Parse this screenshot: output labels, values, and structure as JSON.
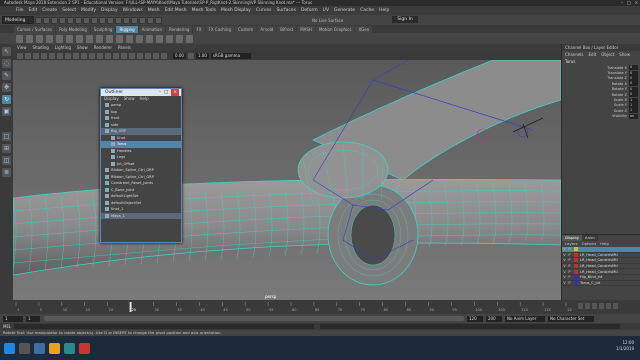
{
  "window": {
    "title": "Autodesk Maya 2018 Extension 2 SP1 - Educational Version: F:\\ULL-\\SP-MAYA\\Knot\\Maya Tutorials\\SP-P_Rig\\Knot-2.Skinning\\VP Skinning Knot.ma* --- Torus",
    "controls": [
      "–",
      "□",
      "×"
    ]
  },
  "menubar": [
    "File",
    "Edit",
    "Create",
    "Select",
    "Modify",
    "Display",
    "Windows",
    "Mesh",
    "Edit Mesh",
    "Mesh Tools",
    "Mesh Display",
    "Curves",
    "Surfaces",
    "Deform",
    "UV",
    "Generate",
    "Cache",
    "Help"
  ],
  "statusline": {
    "mode": "Modeling",
    "live_surface": "No Live Surface",
    "sign_in": "Sign In"
  },
  "shelf_tabs": [
    {
      "label": "Curves / Surfaces",
      "active": false
    },
    {
      "label": "Poly Modeling",
      "active": false
    },
    {
      "label": "Sculpting",
      "active": false
    },
    {
      "label": "Rigging",
      "active": true
    },
    {
      "label": "Animation",
      "active": false
    },
    {
      "label": "Rendering",
      "active": false
    },
    {
      "label": "FX",
      "active": false
    },
    {
      "label": "FX Caching",
      "active": false
    },
    {
      "label": "Custom",
      "active": false
    },
    {
      "label": "Arnold",
      "active": false
    },
    {
      "label": "Bifrost",
      "active": false
    },
    {
      "label": "MASH",
      "active": false
    },
    {
      "label": "Motion Graphics",
      "active": false
    },
    {
      "label": "XGen",
      "active": false
    }
  ],
  "panel_menu": [
    "View",
    "Shading",
    "Lighting",
    "Show",
    "Renderer",
    "Panels"
  ],
  "panel_toolbar": {
    "near": "0.00",
    "far": "1.00",
    "colorspace": "sRGB gamma"
  },
  "viewport": {
    "camera_label": "persp",
    "mesh_color": "#8a8a8a",
    "wire_color": "#39d6c8",
    "joint_color": "#3a3ac8"
  },
  "channel_box": {
    "header": "Channel Box / Layer Editor",
    "menu": [
      "Channels",
      "Edit",
      "Object",
      "Show"
    ],
    "object": "Torus",
    "attributes": [
      {
        "name": "Translate X",
        "value": "0"
      },
      {
        "name": "Translate Y",
        "value": "0"
      },
      {
        "name": "Translate Z",
        "value": "0"
      },
      {
        "name": "Rotate X",
        "value": "0"
      },
      {
        "name": "Rotate Y",
        "value": "0"
      },
      {
        "name": "Rotate Z",
        "value": "0"
      },
      {
        "name": "Scale X",
        "value": "1"
      },
      {
        "name": "Scale Y",
        "value": "1"
      },
      {
        "name": "Scale Z",
        "value": "1"
      },
      {
        "name": "Visibility",
        "value": "on"
      }
    ]
  },
  "layer_editor": {
    "tabs": [
      {
        "label": "Display",
        "active": true
      },
      {
        "label": "Anim",
        "active": false
      }
    ],
    "menu": [
      "Layers",
      "Options",
      "Help"
    ],
    "layers": [
      {
        "v": "V",
        "p": "P",
        "color": "#d8c020",
        "name": "",
        "selected": true
      },
      {
        "v": "V",
        "p": "P",
        "color": "#c03030",
        "name": "LR_Head_ConstrlsMtl",
        "selected": false
      },
      {
        "v": "V",
        "p": "P",
        "color": "#c03030",
        "name": "LR_Head_ConstrlsMtl",
        "selected": false
      },
      {
        "v": "V",
        "p": "P",
        "color": "#c03030",
        "name": "LR_Head_ConstrlsMtl",
        "selected": false
      },
      {
        "v": "V",
        "p": "P",
        "color": "#c03030",
        "name": "LR_Head_ConstrlsMtl",
        "selected": false
      },
      {
        "v": "V",
        "p": "P",
        "color": "#3030c0",
        "name": "Hip_Bind_Jnt",
        "selected": false
      },
      {
        "v": "V",
        "p": "P",
        "color": "#3030c0",
        "name": "Torus_C_Jnt",
        "selected": false
      }
    ]
  },
  "outliner": {
    "title": "Outliner",
    "menu": [
      "Display",
      "Show",
      "Help"
    ],
    "items": [
      {
        "label": "persp",
        "state": "normal"
      },
      {
        "label": "top",
        "state": "normal"
      },
      {
        "label": "front",
        "state": "normal"
      },
      {
        "label": "side",
        "state": "normal"
      },
      {
        "label": "Rig_GRP",
        "state": "hl"
      },
      {
        "label": "Knot",
        "state": "normal"
      },
      {
        "label": "Torus",
        "state": "sel"
      },
      {
        "label": "Handles",
        "state": "normal"
      },
      {
        "label": "Legs",
        "state": "normal"
      },
      {
        "label": "Jnt_Offset",
        "state": "normal"
      },
      {
        "label": "Ribbon_Spline_Ctrl_GRP",
        "state": "normal"
      },
      {
        "label": "Ribbon_Spline_Ctrl_GRP",
        "state": "normal"
      },
      {
        "label": "Constraint_Reset_Joints",
        "state": "normal"
      },
      {
        "label": "C_Bone_Joint",
        "state": "normal"
      },
      {
        "label": "defaultLightSet",
        "state": "normal"
      },
      {
        "label": "defaultObjectSet",
        "state": "normal"
      },
      {
        "label": "Knot_1",
        "state": "normal"
      },
      {
        "label": "Maya_1",
        "state": "hl"
      }
    ]
  },
  "timeslider": {
    "ticks": [
      "1",
      "5",
      "10",
      "15",
      "20",
      "25",
      "30",
      "35",
      "40",
      "45",
      "50",
      "55",
      "60",
      "65",
      "70",
      "75",
      "80",
      "85",
      "90",
      "95",
      "100",
      "105",
      "110",
      "115",
      "120"
    ],
    "current_frame": "25"
  },
  "range": {
    "start": "1",
    "start2": "1",
    "end": "120",
    "end2": "200",
    "end3": "250",
    "anim_layer": "No Anim Layer",
    "char_set": "No Character Set",
    "fps": "24 fps"
  },
  "command_line": "MEL",
  "help_line": "Rotate Tool: Use manipulator to rotate object(s). Use D or INSERT to change the pivot position and axis orientation.",
  "taskbar": {
    "time": "12:00",
    "date": "1/1/2019"
  }
}
